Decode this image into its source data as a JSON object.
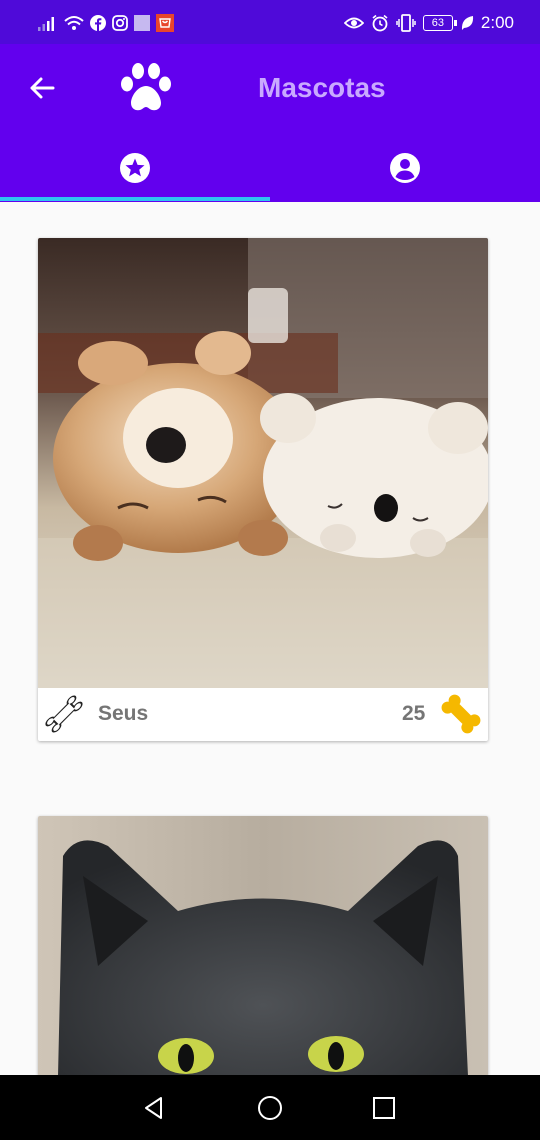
{
  "status_bar": {
    "time": "2:00",
    "battery": "63",
    "icons": [
      "signal-icon",
      "wifi-icon",
      "facebook-icon",
      "instagram-icon",
      "gallery-icon",
      "notification-app-icon",
      "eye-icon",
      "alarm-icon",
      "vibrate-icon",
      "battery-icon",
      "leaf-icon"
    ]
  },
  "app_bar": {
    "title": "Mascotas",
    "back_icon": "arrow-left-icon",
    "logo_icon": "paw-icon"
  },
  "tabs": [
    {
      "icon": "star-circle-icon",
      "selected": true
    },
    {
      "icon": "account-circle-icon",
      "selected": false
    }
  ],
  "colors": {
    "primary": "#6200ee",
    "status_bar": "#4f0ad9",
    "title_text": "#c9a9ff",
    "tab_indicator": "#2ec4f0",
    "bone_accent": "#f5b800"
  },
  "pets": [
    {
      "name": "Seus",
      "rating": "25",
      "photo": "sleeping shiba dog with plush toy"
    },
    {
      "name": "",
      "rating": "",
      "photo": "grey cat with green eyes"
    }
  ],
  "nav_bar": {
    "back": "triangle-back-icon",
    "home": "circle-home-icon",
    "recents": "square-recents-icon"
  }
}
